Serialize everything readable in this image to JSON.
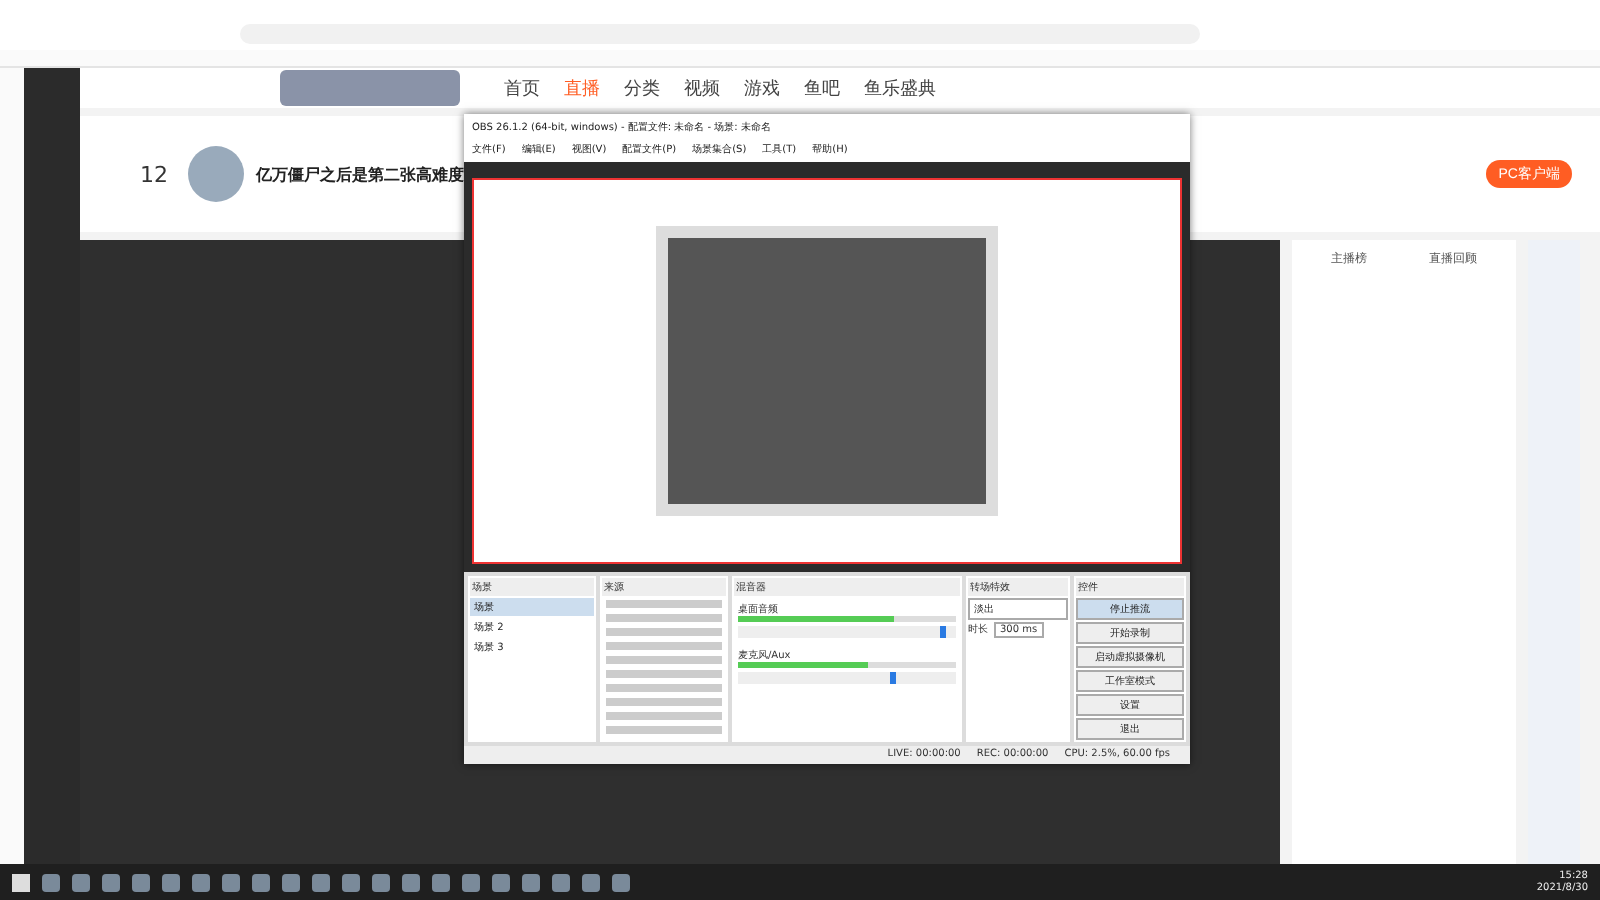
{
  "site_nav": [
    {
      "label": "首页",
      "selected": false
    },
    {
      "label": "直播",
      "selected": true
    },
    {
      "label": "分类",
      "selected": false
    },
    {
      "label": "视频",
      "selected": false
    },
    {
      "label": "游戏",
      "selected": false
    },
    {
      "label": "鱼吧",
      "selected": false
    },
    {
      "label": "鱼乐盛典",
      "selected": false
    }
  ],
  "room": {
    "count": "12",
    "title": "亿万僵尸之后是第二张高难度"
  },
  "client_button": "PC客户端",
  "chat": {
    "tabs": [
      {
        "label": "主播榜",
        "selected": false
      },
      {
        "label": "直播回顾",
        "selected": false
      }
    ]
  },
  "obs": {
    "title": "OBS 26.1.2 (64-bit, windows) - 配置文件: 未命名 - 场景: 未命名",
    "menus": [
      "文件(F)",
      "编辑(E)",
      "视图(V)",
      "配置文件(P)",
      "场景集合(S)",
      "工具(T)",
      "帮助(H)"
    ],
    "docks": [
      "场景",
      "来源",
      "混音器",
      "转场特效",
      "控件"
    ],
    "scenes": [
      {
        "label": "场景",
        "selected": true
      },
      {
        "label": "场景 2",
        "selected": false
      },
      {
        "label": "场景 3",
        "selected": false
      }
    ],
    "mixer": [
      {
        "name": "桌面音频",
        "meter": {
          "level": 0.72
        },
        "fader": {
          "level": 0.95
        }
      },
      {
        "name": "麦克风/Aux",
        "meter": {
          "level": 0.6
        },
        "fader": {
          "level": 0.72
        }
      }
    ],
    "transition": {
      "type": "淡出",
      "duration_label": "时长",
      "duration": "300 ms"
    },
    "controls": [
      {
        "label": "停止推流",
        "selected": true
      },
      {
        "label": "开始录制",
        "selected": false
      },
      {
        "label": "启动虚拟摄像机",
        "selected": false
      },
      {
        "label": "工作室模式",
        "selected": false
      },
      {
        "label": "设置",
        "selected": false
      },
      {
        "label": "退出",
        "selected": false
      }
    ],
    "status": [
      "LIVE: 00:00:00",
      "REC: 00:00:00",
      "CPU: 2.5%, 60.00 fps"
    ]
  },
  "clock": {
    "time": "15:28",
    "date": "2021/8/30"
  }
}
